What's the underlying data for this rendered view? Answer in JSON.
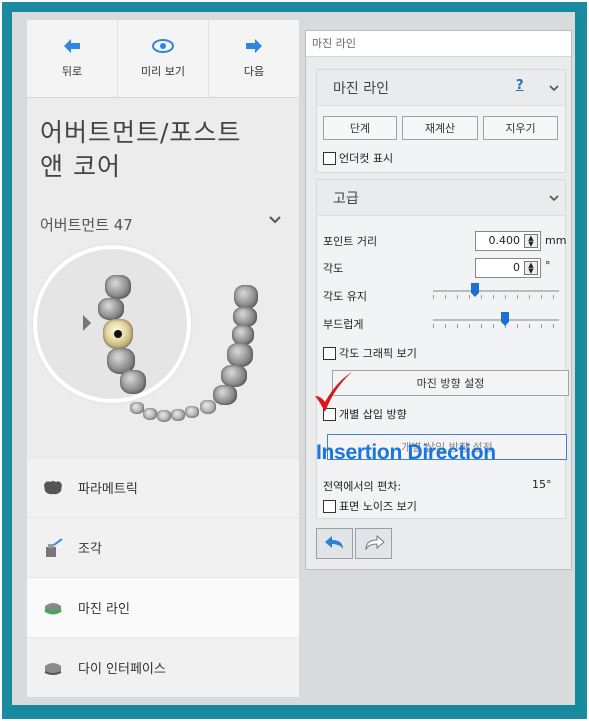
{
  "nav": {
    "back_label": "뒤로",
    "preview_label": "미리 보기",
    "next_label": "다음"
  },
  "page": {
    "title_line1": "어버트먼트/포스트",
    "title_line2": "앤 코어",
    "section_label": "어버트먼트 47"
  },
  "menu": {
    "items": [
      {
        "label": "파라메트릭",
        "icon": "tooth-crown-icon"
      },
      {
        "label": "조각",
        "icon": "sculpt-tool-icon"
      },
      {
        "label": "마진 라인",
        "icon": "margin-line-icon"
      },
      {
        "label": "다이 인터페이스",
        "icon": "die-interface-icon"
      }
    ]
  },
  "dialog": {
    "title": "마진 라인",
    "margin_group": {
      "title": "마진 라인",
      "help_label": "?",
      "buttons": [
        "단계",
        "재계산",
        "지우기"
      ],
      "undercut_label": "언더컷 표시"
    },
    "advanced_group": {
      "title": "고급",
      "point_distance_label": "포인트 거리",
      "point_distance_value": "0.400",
      "point_distance_unit": "mm",
      "angle_label": "각도",
      "angle_value": "0",
      "angle_unit": "°",
      "keep_angle_label": "각도 유지",
      "keep_angle_level": 0.32,
      "smooth_label": "부드럽게",
      "smooth_level": 0.58,
      "show_angle_graphic_label": "각도 그래픽 보기",
      "set_margin_direction_label": "마진 방향 설정",
      "individual_insertion_label": "개별 삽입 방향",
      "insertion_direction_hidden_label": "개별 삽입 방향 설정",
      "global_deviation_label": "전역에서의 편차:",
      "global_deviation_value": "15°",
      "show_surface_noise_label": "표면 노이즈 보기"
    }
  },
  "annotation": {
    "text": "Insertion Direction",
    "color": "#1975e0",
    "check_color": "#e0151a"
  }
}
